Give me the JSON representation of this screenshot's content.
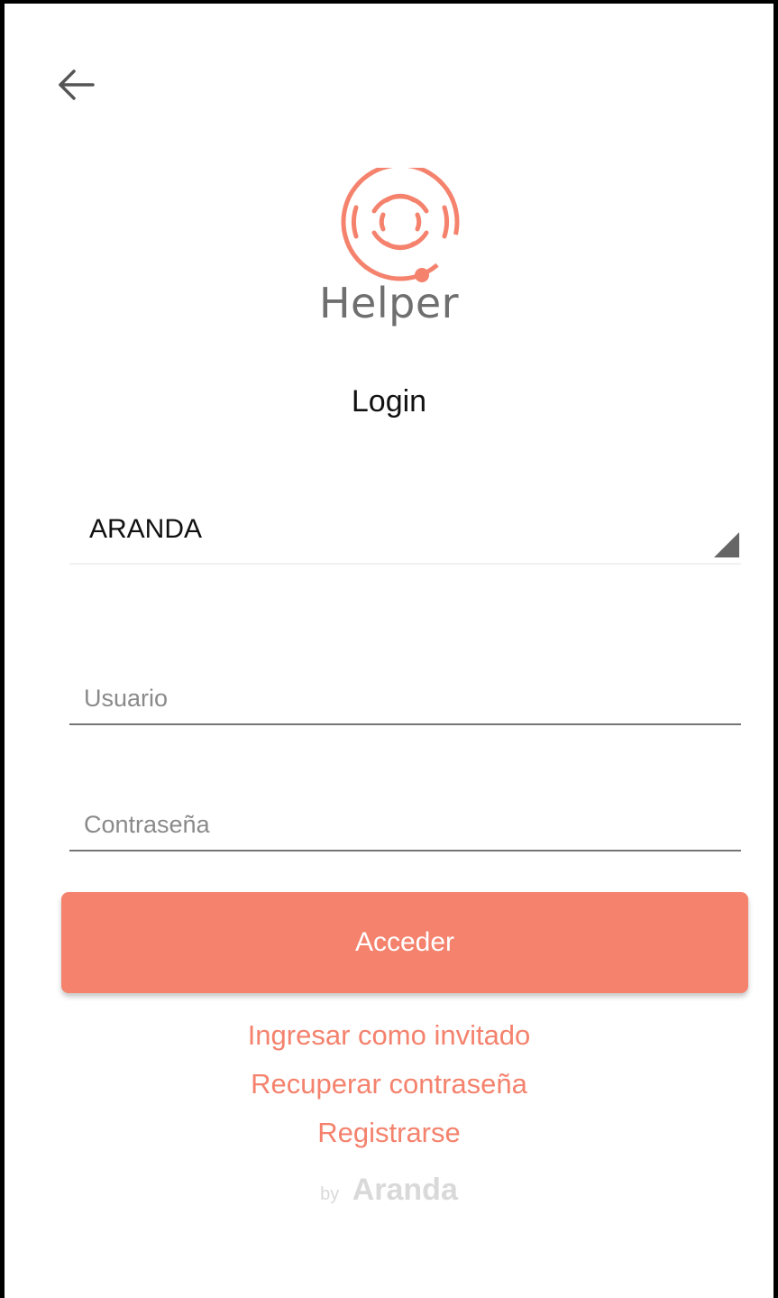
{
  "header": {
    "back_icon": "arrow-left-icon"
  },
  "logo": {
    "icon": "helper-logo-icon",
    "brand_name": "Helper",
    "color": "#f4826d"
  },
  "login": {
    "title": "Login",
    "company_select": {
      "value": "ARANDA"
    },
    "username": {
      "placeholder": "Usuario",
      "value": ""
    },
    "password": {
      "placeholder": "Contraseña",
      "value": ""
    },
    "submit_label": "Acceder"
  },
  "links": {
    "guest": "Ingresar como invitado",
    "recover_password": "Recuperar contraseña",
    "register": "Registrarse"
  },
  "footer": {
    "by": "by",
    "company": "Aranda"
  },
  "colors": {
    "accent": "#f4826d",
    "text": "#111111",
    "muted": "#8a8a8a"
  }
}
